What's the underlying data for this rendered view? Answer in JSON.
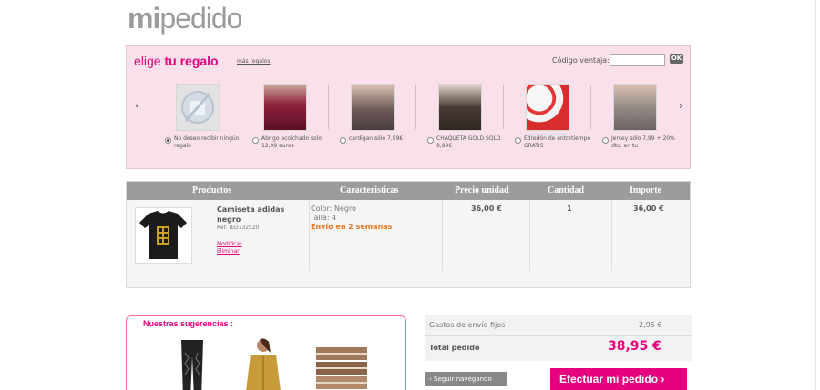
{
  "logo": {
    "part1": "mi",
    "part2": "pedido"
  },
  "gift_panel": {
    "title_part1": "elige",
    "title_part2": "tu regalo",
    "more_link": "más regalos",
    "code_label": "Código ventaja:",
    "code_value": "",
    "ok_label": "OK",
    "prev_arrow": "‹",
    "next_arrow": "›",
    "items": [
      {
        "text": "No deseo recibir ningún regalo",
        "selected": true
      },
      {
        "text": "Abrigo acolchado solo 12,99 euros",
        "selected": false
      },
      {
        "text": "cárdigan sólo 7,99€",
        "selected": false
      },
      {
        "text": "CHAQUETA GOLD SÓLO 9,99€",
        "selected": false
      },
      {
        "text": "Edredón de entretiempo GRATIS",
        "selected": false
      },
      {
        "text": "Jersey sólo 7,99 + 20% dto. en tu",
        "selected": false
      }
    ]
  },
  "cart": {
    "headers": [
      "Productos",
      "Caracteristicas",
      "Precio unidad",
      "Cantidad",
      "Importe"
    ],
    "item": {
      "name": "Camiseta adidas negro",
      "ref": "Ref: IED732520",
      "modify": "Modificar",
      "delete": "Eliminar",
      "color": "Color: Negro",
      "size": "Talla: 4",
      "shipping": "Envío en 2 semanas",
      "unit_price": "36,00 €",
      "quantity": "1",
      "total": "36,00 €"
    }
  },
  "suggestions": {
    "title": "Nuestras sugerencias :"
  },
  "summary": {
    "shipping_label": "Gastos de envío fijos",
    "shipping_value": "2,95 €",
    "total_label": "Total pedido",
    "total_value": "38,95 €"
  },
  "buttons": {
    "back": "‹ Seguir navegando",
    "checkout": "Efectuar mi pedido ›"
  },
  "colors": {
    "accent": "#e6007e",
    "panel_bg": "#f9e0ea",
    "header_bg": "#9c9c9c"
  }
}
